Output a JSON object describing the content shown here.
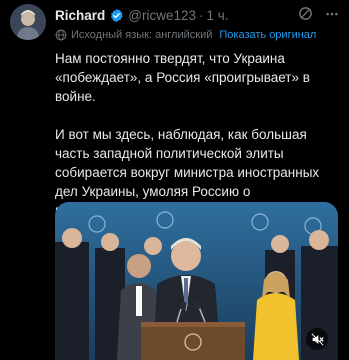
{
  "tweet": {
    "author_name": "Richard",
    "handle": "@ricwe123",
    "separator": "·",
    "time": "1 ч.",
    "translation_note": "Исходный язык: английский",
    "show_original": "Показать оригинал",
    "paragraphs": [
      "Нам постоянно твердят, что Украина «побеждает», а Россия «проигрывает» в войне.",
      "И вот мы здесь, наблюдая, как большая часть западной политической элиты собирается вокруг министра иностранных дел Украины, умоляя Россию о прекращении огня......"
    ]
  },
  "icons": {
    "verified": "verified-badge-icon",
    "grok": "grok-icon",
    "more": "more-icon",
    "translate": "globe-icon",
    "mute": "speaker-muted-icon"
  },
  "colors": {
    "background": "#000000",
    "text": "#e7e9ea",
    "muted": "#71767b",
    "accent": "#1d9bf0"
  }
}
